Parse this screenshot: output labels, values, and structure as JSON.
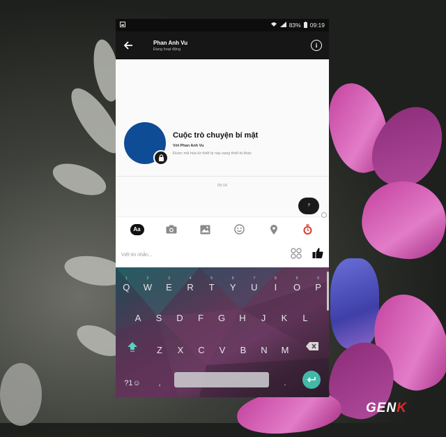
{
  "status_bar": {
    "battery": "83%",
    "time": "09:19"
  },
  "header": {
    "contact_name": "Phan Anh Vu",
    "status": "Đang hoạt động"
  },
  "secret_chat": {
    "title": "Cuộc trò chuyện bí mật",
    "with_label": "Với Phan Anh Vu",
    "encryption_note": "Được mã hóa từ thiết bị này sang thiết bị khác"
  },
  "messages": {
    "timestamp": "09:18",
    "bubble_text": "?"
  },
  "toolbar": {
    "text_style_label": "Aa"
  },
  "composer": {
    "placeholder": "Viết tin nhắn..."
  },
  "keyboard": {
    "row1": [
      {
        "key": "Q",
        "hint": "1"
      },
      {
        "key": "W",
        "hint": "2"
      },
      {
        "key": "E",
        "hint": "3"
      },
      {
        "key": "R",
        "hint": "4"
      },
      {
        "key": "T",
        "hint": "5"
      },
      {
        "key": "Y",
        "hint": "6"
      },
      {
        "key": "U",
        "hint": "7"
      },
      {
        "key": "I",
        "hint": "8"
      },
      {
        "key": "O",
        "hint": "9"
      },
      {
        "key": "P",
        "hint": "0"
      }
    ],
    "row2": [
      "A",
      "S",
      "D",
      "F",
      "G",
      "H",
      "J",
      "K",
      "L"
    ],
    "row3": [
      "Z",
      "X",
      "C",
      "V",
      "B",
      "N",
      "M"
    ],
    "symbols_key": "?1☺",
    "comma_key": ",",
    "period_key": "."
  },
  "watermark": {
    "prefix": "GEN",
    "suffix": "K"
  },
  "colors": {
    "avatar": "#0f4c96",
    "enter_key": "#44b8a8",
    "timer_icon": "#d83a2e"
  }
}
